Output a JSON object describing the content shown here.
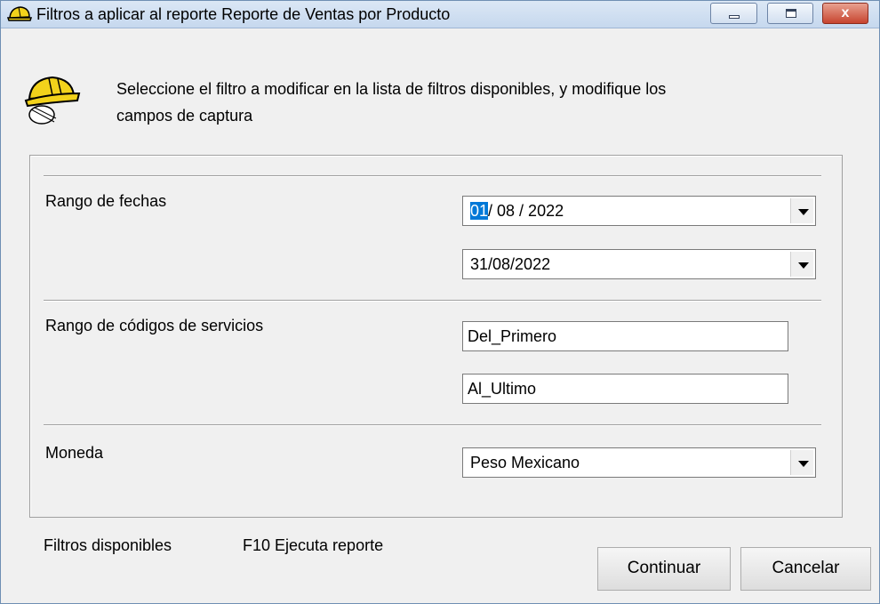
{
  "window": {
    "title": "Filtros a aplicar al reporte Reporte de Ventas por Producto",
    "icon": "hardhat-icon",
    "controls": {
      "minimize": "minimize",
      "maximize": "maximize",
      "close": "x"
    }
  },
  "header": {
    "icon": "hardhat-scroll-icon",
    "instructions_line1": "Seleccione el filtro a modificar  en la lista de filtros disponibles, y modifique los",
    "instructions_line2": "campos de  captura"
  },
  "filters": {
    "date_range": {
      "label": "Rango de fechas",
      "from_day": "01",
      "from_rest": "/ 08 / 2022",
      "to": "31/08/2022"
    },
    "service_codes": {
      "label": "Rango de códigos de servicios",
      "from": "Del_Primero",
      "to": "Al_Ultimo"
    },
    "currency": {
      "label": "Moneda",
      "value": "Peso Mexicano"
    }
  },
  "footer": {
    "available_filters": "Filtros disponibles",
    "hint": "F10 Ejecuta reporte",
    "continue_label": "Continuar",
    "cancel_label": "Cancelar"
  },
  "colors": {
    "selection": "#0078d7",
    "close_button": "#c7442f",
    "window_bg": "#f0f0f0"
  }
}
